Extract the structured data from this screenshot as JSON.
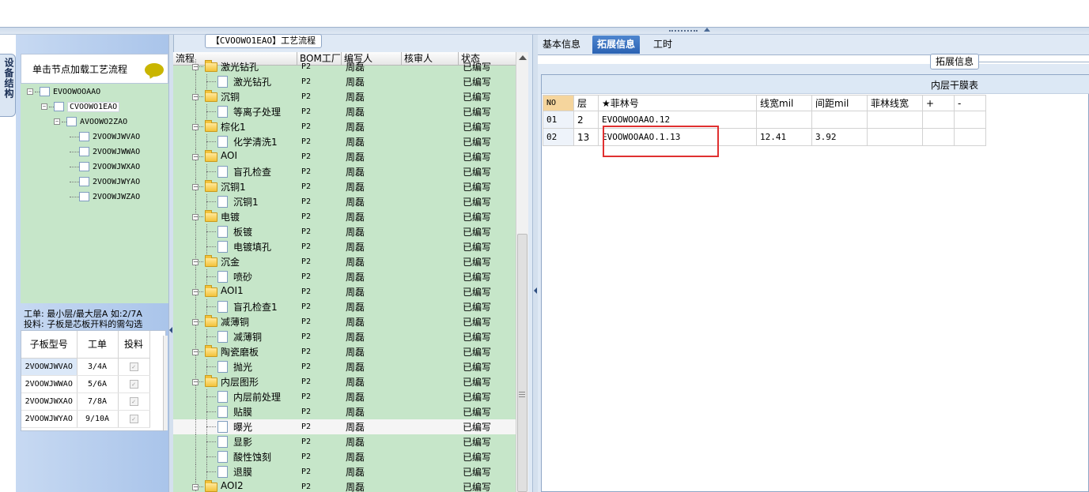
{
  "left_tab": {
    "label": "设备结构"
  },
  "prompt": {
    "label": "单击节点加载工艺流程"
  },
  "tree": {
    "root": "EVOOWOOAAO",
    "child": "CVOOWO1EAO",
    "grand": "AVOOWO2ZAO",
    "leaves": [
      "2VOOWJWVAO",
      "2VOOWJWWAO",
      "2VOOWJWXAO",
      "2VOOWJWYAO",
      "2VOOWJWZAO"
    ]
  },
  "note": {
    "line1": "工单: 最小层/最大层A 如:2/7A",
    "line2": "投料: 子板是芯板开料的需勾选"
  },
  "mini_table": {
    "headers": [
      "子板型号",
      "工单",
      "投料"
    ],
    "rows": [
      {
        "model": "2VOOWJWVAO",
        "order": "3/4A"
      },
      {
        "model": "2VOOWJWWAO",
        "order": "5/6A"
      },
      {
        "model": "2VOOWJWXAO",
        "order": "7/8A"
      },
      {
        "model": "2VOOWJWYAO",
        "order": "9/10A"
      }
    ],
    "check": "✓"
  },
  "process": {
    "title": "【CVOOWO1EAO】工艺流程",
    "headers": [
      "流程",
      "BOM工厂",
      "编写人",
      "核审人",
      "状态"
    ],
    "rows": [
      {
        "type": "folder",
        "name": "激光钻孔",
        "bom": "P2",
        "writer": "周磊",
        "status": "已编写"
      },
      {
        "type": "leaf",
        "name": "激光钻孔",
        "bom": "P2",
        "writer": "周磊",
        "status": "已编写"
      },
      {
        "type": "folder",
        "name": "沉铜",
        "bom": "P2",
        "writer": "周磊",
        "status": "已编写"
      },
      {
        "type": "leaf",
        "name": "等离子处理",
        "bom": "P2",
        "writer": "周磊",
        "status": "已编写"
      },
      {
        "type": "folder",
        "name": "棕化1",
        "bom": "P2",
        "writer": "周磊",
        "status": "已编写"
      },
      {
        "type": "leaf",
        "name": "化学清洗1",
        "bom": "P2",
        "writer": "周磊",
        "status": "已编写"
      },
      {
        "type": "folder",
        "name": "AOI",
        "bom": "P2",
        "writer": "周磊",
        "status": "已编写"
      },
      {
        "type": "leaf",
        "name": "盲孔检查",
        "bom": "P2",
        "writer": "周磊",
        "status": "已编写"
      },
      {
        "type": "folder",
        "name": "沉铜1",
        "bom": "P2",
        "writer": "周磊",
        "status": "已编写"
      },
      {
        "type": "leaf",
        "name": "沉铜1",
        "bom": "P2",
        "writer": "周磊",
        "status": "已编写"
      },
      {
        "type": "folder",
        "name": "电镀",
        "bom": "P2",
        "writer": "周磊",
        "status": "已编写"
      },
      {
        "type": "leaf",
        "name": "板镀",
        "bom": "P2",
        "writer": "周磊",
        "status": "已编写"
      },
      {
        "type": "leaf",
        "name": "电镀填孔",
        "bom": "P2",
        "writer": "周磊",
        "status": "已编写"
      },
      {
        "type": "folder",
        "name": "沉金",
        "bom": "P2",
        "writer": "周磊",
        "status": "已编写"
      },
      {
        "type": "leaf",
        "name": "喷砂",
        "bom": "P2",
        "writer": "周磊",
        "status": "已编写"
      },
      {
        "type": "folder",
        "name": "AOI1",
        "bom": "P2",
        "writer": "周磊",
        "status": "已编写"
      },
      {
        "type": "leaf",
        "name": "盲孔检查1",
        "bom": "P2",
        "writer": "周磊",
        "status": "已编写"
      },
      {
        "type": "folder",
        "name": "减薄铜",
        "bom": "P2",
        "writer": "周磊",
        "status": "已编写"
      },
      {
        "type": "leaf",
        "name": "减薄铜",
        "bom": "P2",
        "writer": "周磊",
        "status": "已编写"
      },
      {
        "type": "folder",
        "name": "陶瓷磨板",
        "bom": "P2",
        "writer": "周磊",
        "status": "已编写"
      },
      {
        "type": "leaf",
        "name": "抛光",
        "bom": "P2",
        "writer": "周磊",
        "status": "已编写"
      },
      {
        "type": "folder",
        "name": "内层图形",
        "bom": "P2",
        "writer": "周磊",
        "status": "已编写"
      },
      {
        "type": "leaf",
        "name": "内层前处理",
        "bom": "P2",
        "writer": "周磊",
        "status": "已编写"
      },
      {
        "type": "leaf",
        "name": "贴膜",
        "bom": "P2",
        "writer": "周磊",
        "status": "已编写"
      },
      {
        "type": "leaf",
        "name": "曝光",
        "bom": "P2",
        "writer": "周磊",
        "status": "已编写",
        "selected": true
      },
      {
        "type": "leaf",
        "name": "显影",
        "bom": "P2",
        "writer": "周磊",
        "status": "已编写"
      },
      {
        "type": "leaf",
        "name": "酸性蚀刻",
        "bom": "P2",
        "writer": "周磊",
        "status": "已编写"
      },
      {
        "type": "leaf",
        "name": "退膜",
        "bom": "P2",
        "writer": "周磊",
        "status": "已编写"
      },
      {
        "type": "folder",
        "name": "AOI2",
        "bom": "P2",
        "writer": "周磊",
        "status": "已编写"
      }
    ]
  },
  "right_tabs": [
    {
      "label": "基本信息"
    },
    {
      "label": "拓展信息",
      "active": true
    },
    {
      "label": "工时"
    }
  ],
  "ext": {
    "title": "拓展信息",
    "table_title": "内层干膜表",
    "headers": [
      "NO",
      "层",
      "★菲林号",
      "线宽mil",
      "间距mil",
      "菲林线宽",
      "+",
      "-"
    ],
    "rows": [
      {
        "no": "01",
        "layer": "2",
        "film": "EVOOWOOAAO.12",
        "width": "",
        "space": "",
        "fw": ""
      },
      {
        "no": "02",
        "layer": "13",
        "film": "EVOOWOOAAO.1.13",
        "width": "12.41",
        "space": "3.92",
        "fw": ""
      }
    ]
  }
}
